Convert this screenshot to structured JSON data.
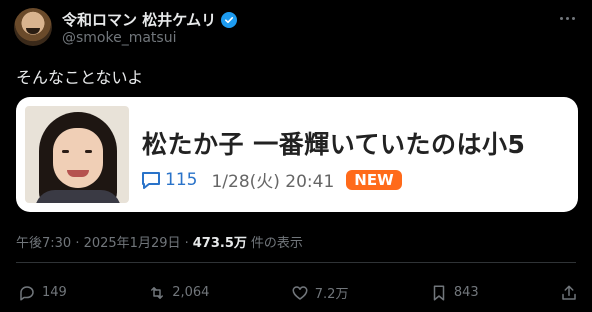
{
  "author": {
    "display_name": "令和ロマン 松井ケムリ",
    "handle": "@smoke_matsui"
  },
  "post": {
    "text": "そんなことないよ"
  },
  "card": {
    "title": "松たか子 一番輝いていたのは小5",
    "comment_count": "115",
    "date": "1/28(火) 20:41",
    "badge": "NEW"
  },
  "meta": {
    "timestamp": "午後7:30 · 2025年1月29日 ·",
    "views": "473.5万",
    "views_label": "件の表示"
  },
  "actions": {
    "replies": "149",
    "reposts": "2,064",
    "likes": "7.2万",
    "bookmarks": "843"
  },
  "colors": {
    "background": "#000000",
    "verified": "#1d9bf0",
    "badge": "#ff6a1a",
    "link": "#2a73c9"
  },
  "icons": [
    "verified-icon",
    "more-icon",
    "comment-icon",
    "reply-icon",
    "repost-icon",
    "like-icon",
    "bookmark-icon",
    "share-icon"
  ]
}
